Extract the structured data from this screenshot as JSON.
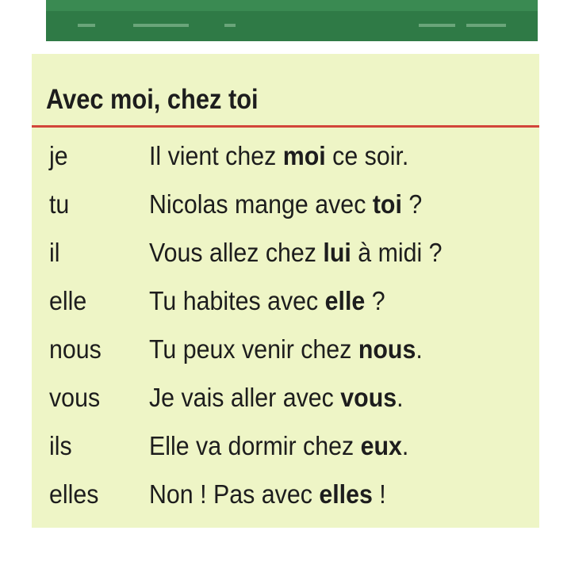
{
  "card": {
    "title": "Avec moi, chez toi",
    "rows": [
      {
        "pronoun": "je",
        "before": "Il vient chez ",
        "bold": "moi",
        "after": " ce soir."
      },
      {
        "pronoun": "tu",
        "before": "Nicolas mange avec ",
        "bold": "toi",
        "after": " ?"
      },
      {
        "pronoun": "il",
        "before": "Vous allez chez ",
        "bold": "lui",
        "after": " à midi ?"
      },
      {
        "pronoun": "elle",
        "before": "Tu habites avec ",
        "bold": "elle",
        "after": " ?"
      },
      {
        "pronoun": "nous",
        "before": "Tu peux venir chez ",
        "bold": "nous",
        "after": "."
      },
      {
        "pronoun": "vous",
        "before": "Je vais aller avec ",
        "bold": "vous",
        "after": "."
      },
      {
        "pronoun": "ils",
        "before": "Elle va dormir chez ",
        "bold": "eux",
        "after": "."
      },
      {
        "pronoun": "elles",
        "before": "Non ! Pas avec ",
        "bold": "elles",
        "after": " !"
      }
    ]
  },
  "colors": {
    "card_background": "#eef5c6",
    "title_rule": "#d2453a",
    "top_strip": "#2f7a46",
    "text": "#1d1d1d"
  }
}
